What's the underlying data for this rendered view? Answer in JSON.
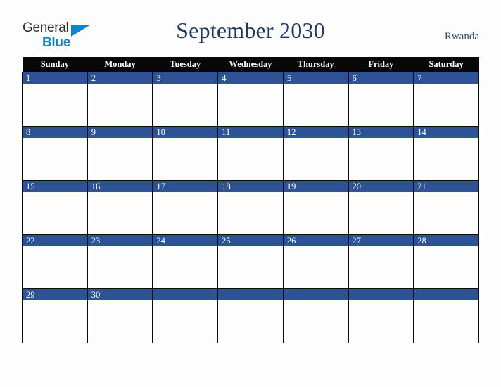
{
  "brand": {
    "name_part1": "General",
    "name_part2": "Blue",
    "triangle_icon": "triangle-icon",
    "accent_color": "#1283c8",
    "text_color": "#2b2b2b"
  },
  "header": {
    "title": "September 2030",
    "month": "September",
    "year": "2030",
    "region": "Rwanda",
    "title_color": "#1f3864",
    "region_color": "#2e4b7a"
  },
  "calendar": {
    "header_background": "#080808",
    "header_text_color": "#ffffff",
    "daybar_color": "#2e5395",
    "daynum_color": "#ffffff",
    "cell_background": "#fdfdfd",
    "border_color": "#0a0a0a",
    "weekdays": [
      "Sunday",
      "Monday",
      "Tuesday",
      "Wednesday",
      "Thursday",
      "Friday",
      "Saturday"
    ],
    "weeks": [
      [
        "1",
        "2",
        "3",
        "4",
        "5",
        "6",
        "7"
      ],
      [
        "8",
        "9",
        "10",
        "11",
        "12",
        "13",
        "14"
      ],
      [
        "15",
        "16",
        "17",
        "18",
        "19",
        "20",
        "21"
      ],
      [
        "22",
        "23",
        "24",
        "25",
        "26",
        "27",
        "28"
      ],
      [
        "29",
        "30",
        "",
        "",
        "",
        "",
        ""
      ]
    ]
  }
}
